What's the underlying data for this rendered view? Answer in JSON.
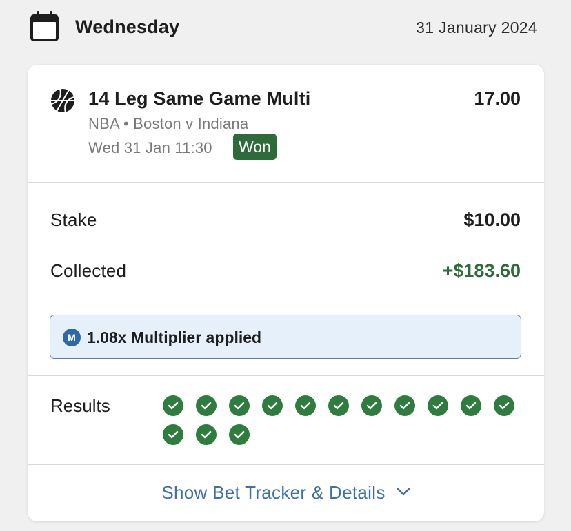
{
  "header": {
    "day": "Wednesday",
    "date": "31 January 2024",
    "icon": "calendar-icon"
  },
  "bet": {
    "sport_icon": "basketball-icon",
    "title": "14 Leg Same Game Multi",
    "odds": "17.00",
    "competition": "NBA",
    "separator": "•",
    "match": "Boston v Indiana",
    "time": "Wed 31 Jan 11:30",
    "status": "Won"
  },
  "stake": {
    "label": "Stake",
    "value": "$10.00"
  },
  "collected": {
    "label": "Collected",
    "value": "+$183.60"
  },
  "multiplier": {
    "icon_letter": "M",
    "text": "1.08x Multiplier applied"
  },
  "results": {
    "label": "Results",
    "legs": [
      "won",
      "won",
      "won",
      "won",
      "won",
      "won",
      "won",
      "won",
      "won",
      "won",
      "won",
      "won",
      "won",
      "won"
    ]
  },
  "footer": {
    "link_label": "Show Bet Tracker & Details",
    "icon": "chevron-down-icon"
  },
  "colors": {
    "won_green": "#2e6b3a",
    "check_green": "#2f7d3e",
    "link_blue": "#3d72a8",
    "multiplier_bg": "#e6f0fb"
  }
}
